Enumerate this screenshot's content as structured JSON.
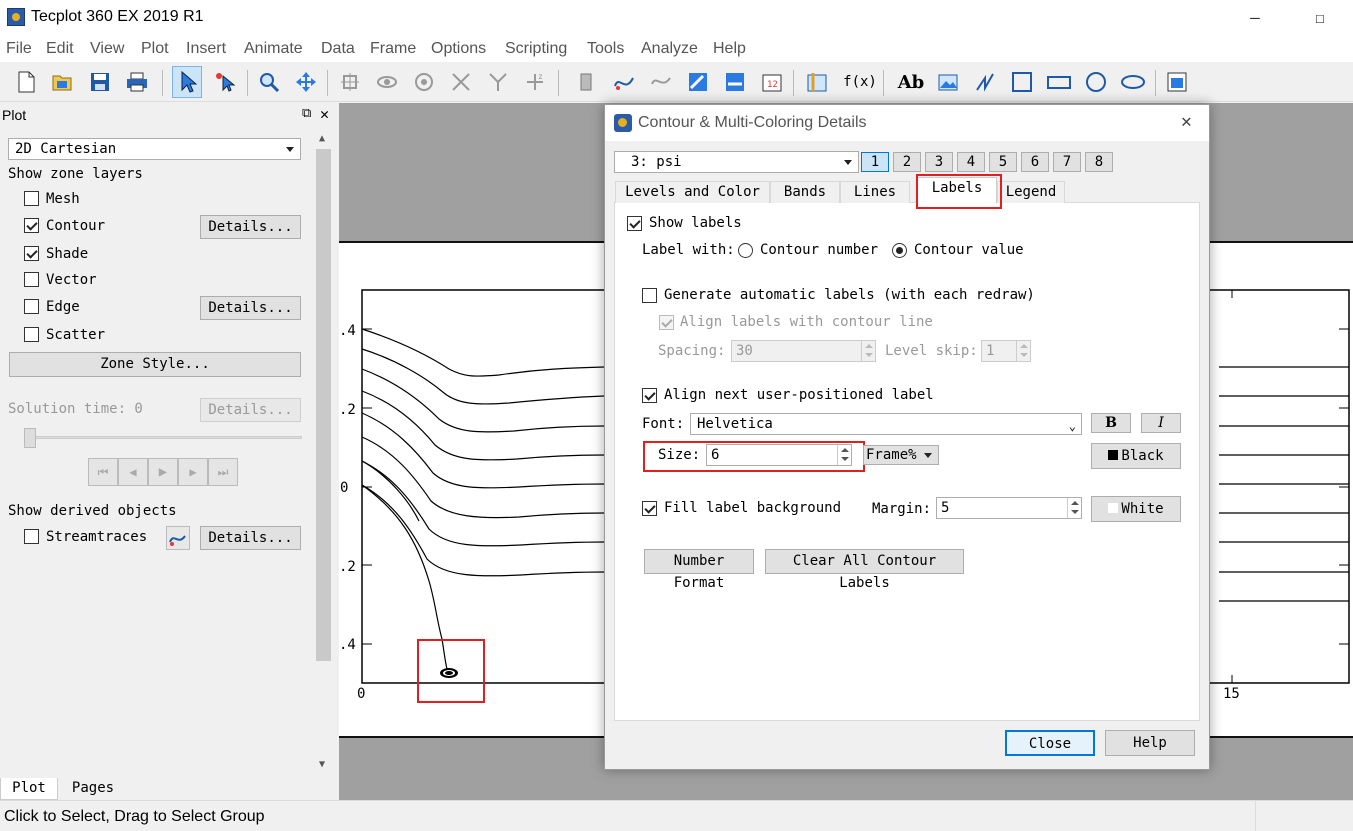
{
  "app": {
    "title": "Tecplot 360 EX 2019 R1",
    "window_controls": {
      "minimize": "—",
      "maximize": "☐"
    }
  },
  "menu": [
    "File",
    "Edit",
    "View",
    "Plot",
    "Insert",
    "Animate",
    "Data",
    "Frame",
    "Options",
    "Scripting",
    "Tools",
    "Analyze",
    "Help"
  ],
  "toolbar": {
    "icons": [
      "new-layout-icon",
      "open-icon",
      "save-icon",
      "print-icon",
      "select-pointer-icon",
      "adjustor-icon",
      "zoom-icon",
      "translate-icon",
      "rotate-3d-icon",
      "rotate-spherical-icon",
      "rotate-rollerball-icon",
      "rotate-x-icon",
      "rotate-y-icon",
      "rotate-z-icon",
      "probe-icon",
      "streamtrace-icon",
      "streamtrace-rake-icon",
      "contour-add-icon",
      "contour-remove-icon",
      "contour-label-icon",
      "slice-icon",
      "equation-icon",
      "text-icon",
      "image-icon",
      "polyline-icon",
      "square-icon",
      "rectangle-icon",
      "circle-icon",
      "ellipse-icon",
      "frame-icon"
    ],
    "fx_label": "f(x)",
    "ab_label": "Ab"
  },
  "left_panel": {
    "header": "Plot",
    "plot_type": "2D Cartesian",
    "show_zone_layers_label": "Show zone layers",
    "layers": [
      {
        "label": "Mesh",
        "checked": false,
        "details": false
      },
      {
        "label": "Contour",
        "checked": true,
        "details": true
      },
      {
        "label": "Shade",
        "checked": true,
        "details": false
      },
      {
        "label": "Vector",
        "checked": false,
        "details": false
      },
      {
        "label": "Edge",
        "checked": false,
        "details": true
      },
      {
        "label": "Scatter",
        "checked": false,
        "details": false
      }
    ],
    "details_label": "Details...",
    "zone_style_label": "Zone Style...",
    "solution_time_label": "Solution time: 0",
    "show_derived_label": "Show derived objects",
    "streamtraces_label": "Streamtraces",
    "bottom_tabs": [
      "Plot",
      "Pages"
    ]
  },
  "plot": {
    "y_ticks": [
      ".4",
      ".2",
      "0",
      ".2",
      ".4"
    ],
    "x_ticks_left": "0",
    "x_ticks_right": "15"
  },
  "dialog": {
    "title": "Contour & Multi-Coloring Details",
    "variable": "3: psi",
    "group_numbers": [
      "1",
      "2",
      "3",
      "4",
      "5",
      "6",
      "7",
      "8"
    ],
    "selected_group": "1",
    "tabs": [
      "Levels and Color",
      "Bands",
      "Lines",
      "Labels",
      "Legend"
    ],
    "selected_tab": "Labels",
    "show_labels": {
      "label": "Show labels",
      "checked": true
    },
    "label_with": {
      "label": "Label with:",
      "options": [
        "Contour number",
        "Contour value"
      ],
      "selected": "Contour value"
    },
    "generate_auto": {
      "label": "Generate automatic labels (with each redraw)",
      "checked": false
    },
    "align_labels": {
      "label": "Align labels with contour line",
      "checked": true,
      "disabled": true
    },
    "spacing": {
      "label": "Spacing:",
      "value": "30"
    },
    "level_skip": {
      "label": "Level skip:",
      "value": "1"
    },
    "align_next": {
      "label": "Align next user-positioned label",
      "checked": true
    },
    "font": {
      "label": "Font:",
      "value": "Helvetica",
      "bold": "B",
      "italic": "I"
    },
    "size": {
      "label": "Size:",
      "value": "6",
      "unit": "Frame%"
    },
    "color_button": {
      "label": "Black",
      "swatch": "#000000"
    },
    "fill_background": {
      "label": "Fill label background",
      "checked": true
    },
    "margin": {
      "label": "Margin:",
      "value": "5"
    },
    "bg_color_button": {
      "label": "White",
      "swatch": "#ffffff"
    },
    "number_format": "Number Format",
    "clear_all": "Clear All Contour Labels",
    "close": "Close",
    "help": "Help"
  },
  "status": {
    "text": "Click to Select, Drag to Select Group"
  },
  "colors": {
    "highlight_red": "#e02020",
    "selection_blue": "#0078d7"
  }
}
